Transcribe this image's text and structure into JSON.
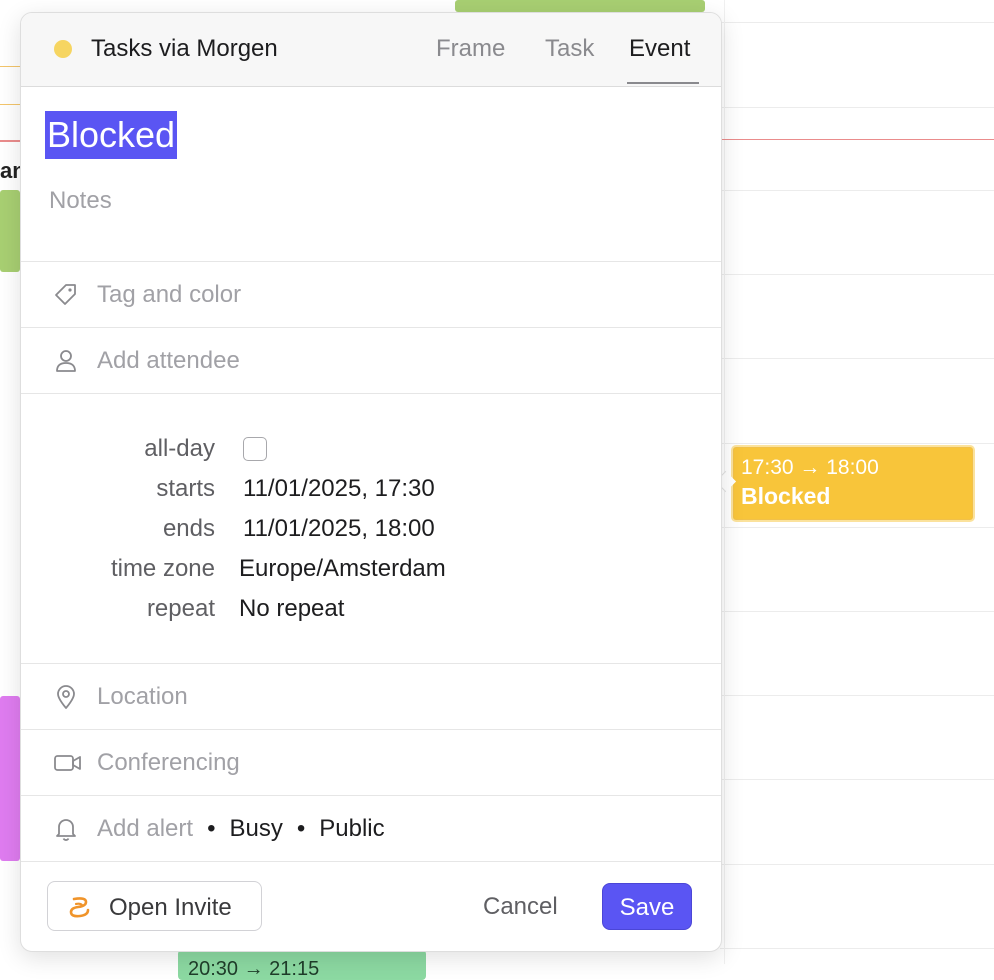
{
  "popover": {
    "calendar_name": "Tasks via Morgen",
    "calendar_color": "#f6d561",
    "tabs": [
      {
        "label": "Frame",
        "active": false
      },
      {
        "label": "Task",
        "active": false
      },
      {
        "label": "Event",
        "active": true
      }
    ],
    "title": "Blocked",
    "notes_placeholder": "Notes",
    "tag_placeholder": "Tag and color",
    "attendee_placeholder": "Add attendee",
    "form": {
      "allday_label": "all-day",
      "allday_checked": false,
      "starts_label": "starts",
      "starts_value": "11/01/2025, 17:30",
      "ends_label": "ends",
      "ends_value": "11/01/2025, 18:00",
      "timezone_label": "time zone",
      "timezone_value": "Europe/Amsterdam",
      "repeat_label": "repeat",
      "repeat_value": "No repeat"
    },
    "location_placeholder": "Location",
    "conferencing_placeholder": "Conferencing",
    "alert_placeholder": "Add alert",
    "availability": "Busy",
    "visibility": "Public",
    "separator": "•",
    "open_invite_label": "Open Invite",
    "cancel_label": "Cancel",
    "save_label": "Save",
    "accent_color": "#5a55f3"
  },
  "calendar": {
    "selected_event": {
      "time": "17:30 → 18:00",
      "title": "Blocked",
      "color": "#f8c53a"
    },
    "partial_label": "an",
    "partial_bottom_time": "20:30 → 21:15"
  }
}
